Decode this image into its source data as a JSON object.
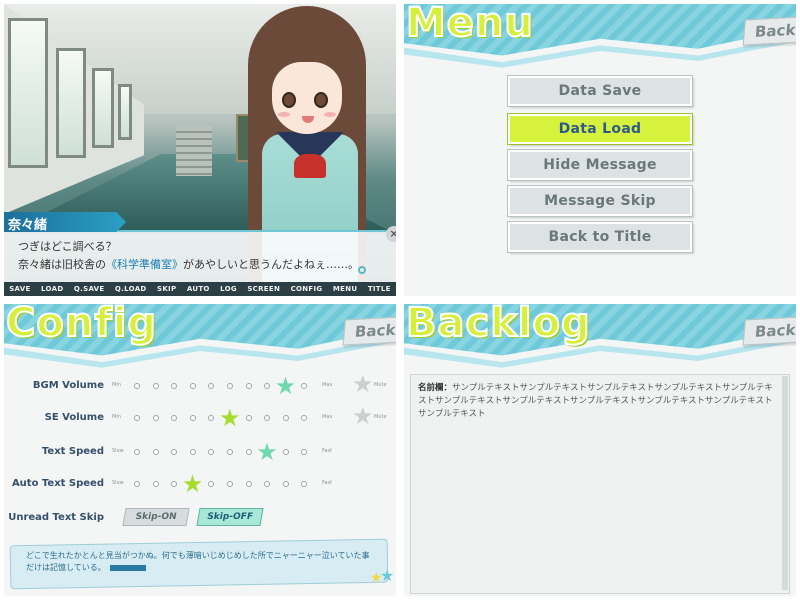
{
  "scene": {
    "character_name": "奈々緒",
    "line1": "つぎはどこ調べる？",
    "line2_pre": "奈々緒は旧校舎の",
    "line2_highlight": "《科学準備室》",
    "line2_post": "があやしいと思うんだよねぇ……。",
    "close_label": "×",
    "quickbar": [
      "SAVE",
      "LOAD",
      "Q.SAVE",
      "Q.LOAD",
      "SKIP",
      "AUTO",
      "LOG",
      "SCREEN",
      "CONFIG",
      "MENU",
      "TITLE"
    ]
  },
  "menu": {
    "title": "Menu",
    "back": "Back",
    "items": [
      "Data Save",
      "Data Load",
      "Hide Message",
      "Message Skip",
      "Back to Title"
    ],
    "active_item": "Data Load"
  },
  "config": {
    "title": "Config",
    "back": "Back",
    "rows": [
      {
        "label": "BGM Volume",
        "left_tag": "Min",
        "right_tag": "Max",
        "level_of_10": 9,
        "mute_label": "Mute",
        "star_color": "#6fd9b0"
      },
      {
        "label": "SE Volume",
        "left_tag": "Min",
        "right_tag": "Max",
        "level_of_10": 6,
        "mute_label": "Mute",
        "star_color": "#a5dd2e"
      },
      {
        "label": "Text Speed",
        "left_tag": "Slow",
        "right_tag": "Fast",
        "level_of_10": 8,
        "star_color": "#6fd9b0"
      },
      {
        "label": "Auto Text Speed",
        "left_tag": "Slow",
        "right_tag": "Fast",
        "level_of_10": 4,
        "star_color": "#a5dd2e"
      }
    ],
    "unread_label": "Unread Text Skip",
    "skip_on": "Skip-ON",
    "skip_off": "Skip-OFF",
    "skip_selected": "Skip-OFF",
    "sample_text": "どこで生れたかとんと見当がつかぬ。何でも薄暗いじめじめした所でニャーニャー泣いていた事だけは記憶している。"
  },
  "backlog": {
    "title": "Backlog",
    "back": "Back",
    "entry_name": "名前欄：",
    "entry_text": "サンプルテキストサンプルテキストサンプルテキストサンプルテキストサンプルテキストサンプルテキストサンプルテキストサンプルテキストサンプルテキストサンプルテキストサンプルテキスト"
  },
  "colors": {
    "accent_green": "#d6f23c",
    "accent_cyan": "#6fc9d8",
    "text_blue": "#35506b"
  }
}
